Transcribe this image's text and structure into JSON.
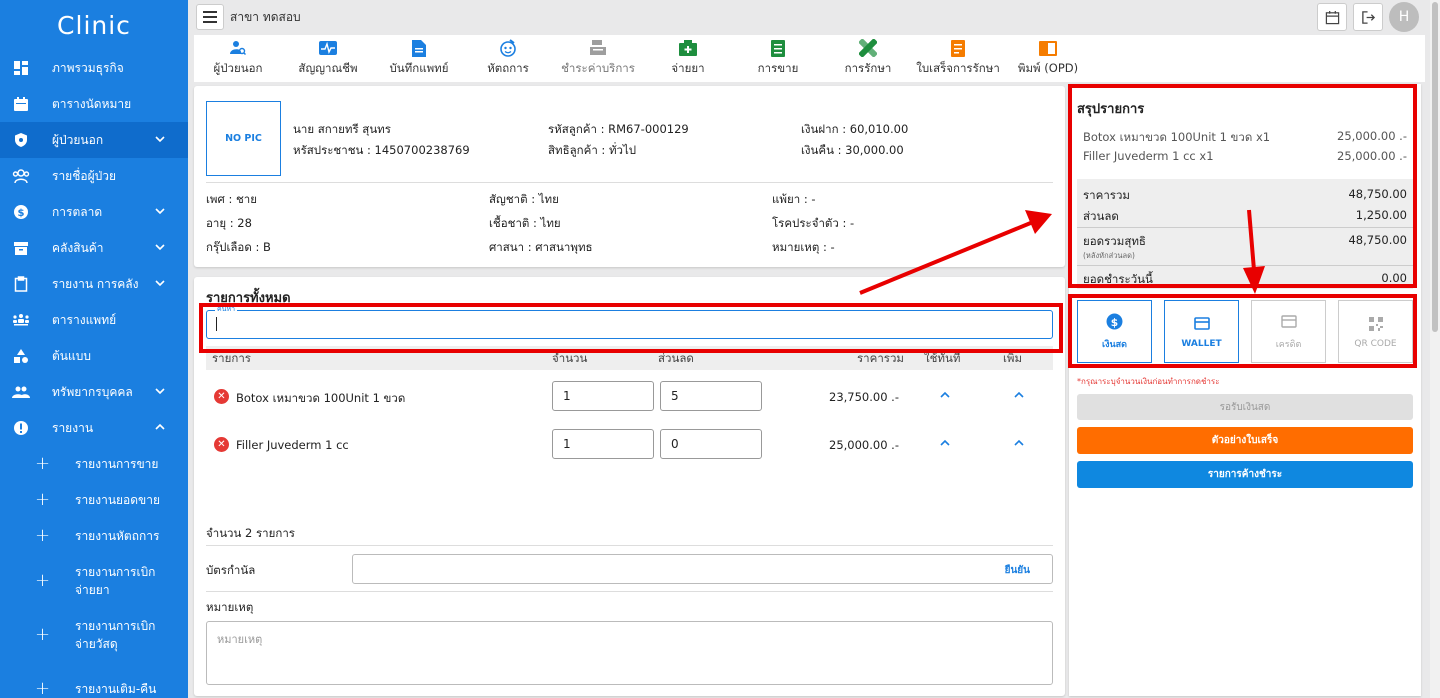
{
  "sidebar": {
    "brand": "Clinic",
    "items": [
      {
        "label": "ภาพรวมธุรกิจ",
        "icon": "dashboard-icon",
        "chevron": ""
      },
      {
        "label": "ตารางนัดหมาย",
        "icon": "calendar-icon",
        "chevron": ""
      },
      {
        "label": "ผู้ป่วยนอก",
        "icon": "shield-icon",
        "chevron": "down"
      },
      {
        "label": "รายชื่อผู้ป่วย",
        "icon": "people-icon",
        "chevron": ""
      },
      {
        "label": "การตลาด",
        "icon": "dollar-icon",
        "chevron": "down"
      },
      {
        "label": "คลังสินค้า",
        "icon": "archive-icon",
        "chevron": "down"
      },
      {
        "label": "รายงาน การคลัง",
        "icon": "clipboard-icon",
        "chevron": "down"
      },
      {
        "label": "ตารางแพทย์",
        "icon": "team-icon",
        "chevron": ""
      },
      {
        "label": "ต้นแบบ",
        "icon": "shapes-icon",
        "chevron": ""
      },
      {
        "label": "ทรัพยากรบุคคล",
        "icon": "group-icon",
        "chevron": "down"
      },
      {
        "label": "รายงาน",
        "icon": "alert-icon",
        "chevron": "up"
      }
    ],
    "sub_items": [
      {
        "label": "รายงานการขาย"
      },
      {
        "label": "รายงานยอดขาย"
      },
      {
        "label": "รายงานหัตถการ"
      },
      {
        "label": "รายงานการเบิก จ่ายยา"
      },
      {
        "label": "รายงานการเบิก จ่ายวัสดุ"
      },
      {
        "label": "รายงานเติม-คืน"
      }
    ]
  },
  "topbar": {
    "branch": "สาขา ทดสอบ",
    "avatar_initial": "H"
  },
  "tabs": [
    {
      "label": "ผู้ป่วยนอก",
      "icon": "patient-search-icon",
      "color": "#1b7fe0"
    },
    {
      "label": "สัญญาณชีพ",
      "icon": "vital-signs-icon",
      "color": "#1b7fe0"
    },
    {
      "label": "บันทึกแพทย์",
      "icon": "doctor-note-icon",
      "color": "#1b7fe0"
    },
    {
      "label": "หัตถการ",
      "icon": "procedure-icon",
      "color": "#1b7fe0"
    },
    {
      "label": "ชำระค่าบริการ",
      "icon": "cash-register-icon",
      "color": "#9e9e9e"
    },
    {
      "label": "จ่ายยา",
      "icon": "medicine-icon",
      "color": "#1e8e3e"
    },
    {
      "label": "การขาย",
      "icon": "sales-icon",
      "color": "#1e8e3e"
    },
    {
      "label": "การรักษา",
      "icon": "bandage-icon",
      "color": "#1e8e3e"
    },
    {
      "label": "ใบเสร็จการรักษา",
      "icon": "receipt-icon",
      "color": "#f57c00"
    },
    {
      "label": "พิมพ์ (OPD)",
      "icon": "print-icon",
      "color": "#f57c00"
    }
  ],
  "patient": {
    "pic": "NO PIC",
    "name": "นาย สกายทรี สุนทร",
    "id_card": "หรัสประชาชน : 1450700238769",
    "customer_code": "รหัสลูกค้า : RM67-000129",
    "customer_right": "สิทธิลูกค้า : ทั่วไป",
    "deposit": "เงินฝาก : 60,010.00",
    "refund": "เงินคืน : 30,000.00",
    "sex": "เพศ : ชาย",
    "age": "อายุ : 28",
    "blood": "กรุ๊ปเลือด : B",
    "nationality": "สัญชาติ : ไทย",
    "race": "เชื้อชาติ : ไทย",
    "religion": "ศาสนา : ศาสนาพุทธ",
    "allergy": "แพ้ยา : -",
    "disease": "โรคประจำตัว : -",
    "note": "หมายเหตุ : -"
  },
  "items_section": {
    "title": "รายการทั้งหมด",
    "search_label": "ค้นหา",
    "search_value": "",
    "headers": {
      "item": "รายการ",
      "qty": "จำนวน",
      "discount": "ส่วนลด",
      "total": "ราคารวม",
      "use_now": "ใช้ทันที",
      "add": "เพิ่ม"
    },
    "rows": [
      {
        "name": "Botox เหมาขวด 100Unit 1 ขวด",
        "qty": "1",
        "discount": "5",
        "total": "23,750.00 .-"
      },
      {
        "name": "Filler Juvederm 1 cc",
        "qty": "1",
        "discount": "0",
        "total": "25,000.00 .-"
      }
    ],
    "count": "จำนวน 2 รายการ",
    "coupon_label": "บัตรกำนัล",
    "coupon_confirm": "ยืนยัน",
    "remark_label": "หมายเหตุ",
    "remark_placeholder": "หมายเหตุ"
  },
  "summary": {
    "title": "สรุปรายการ",
    "lines": [
      {
        "name": "Botox เหมาขวด 100Unit 1 ขวด x1",
        "price": "25,000.00 .-"
      },
      {
        "name": "Filler Juvederm 1 cc x1",
        "price": "25,000.00 .-"
      }
    ],
    "subtotal_label": "ราคารวม",
    "subtotal": "48,750.00",
    "discount_label": "ส่วนลด",
    "discount": "1,250.00",
    "net_label": "ยอดรวมสุทธิ",
    "net_sub": "(หลังหักส่วนลด)",
    "net": "48,750.00",
    "today_label": "ยอดชำระวันนี้",
    "today": "0.00"
  },
  "payment": {
    "methods": [
      {
        "label": "เงินสด",
        "icon": "dollar-circle-icon",
        "state": "selected"
      },
      {
        "label": "WALLET",
        "icon": "wallet-icon",
        "state": "selected"
      },
      {
        "label": "เครดิต",
        "icon": "credit-card-icon",
        "state": "disabled"
      },
      {
        "label": "QR CODE",
        "icon": "qr-code-icon",
        "state": "disabled"
      }
    ],
    "warning": "*กรุณาระบุจำนวนเงินก่อนทำการกดชำระ",
    "receive_cash": "รอรับเงินสด",
    "preview_receipt": "ตัวอย่างใบเสร็จ",
    "pending_items": "รายการค้างชำระ"
  },
  "colors": {
    "primary": "#1b7fe0",
    "highlight_box": "#e80000",
    "orange": "#ff6d00",
    "blue_button": "#0f88e0"
  }
}
